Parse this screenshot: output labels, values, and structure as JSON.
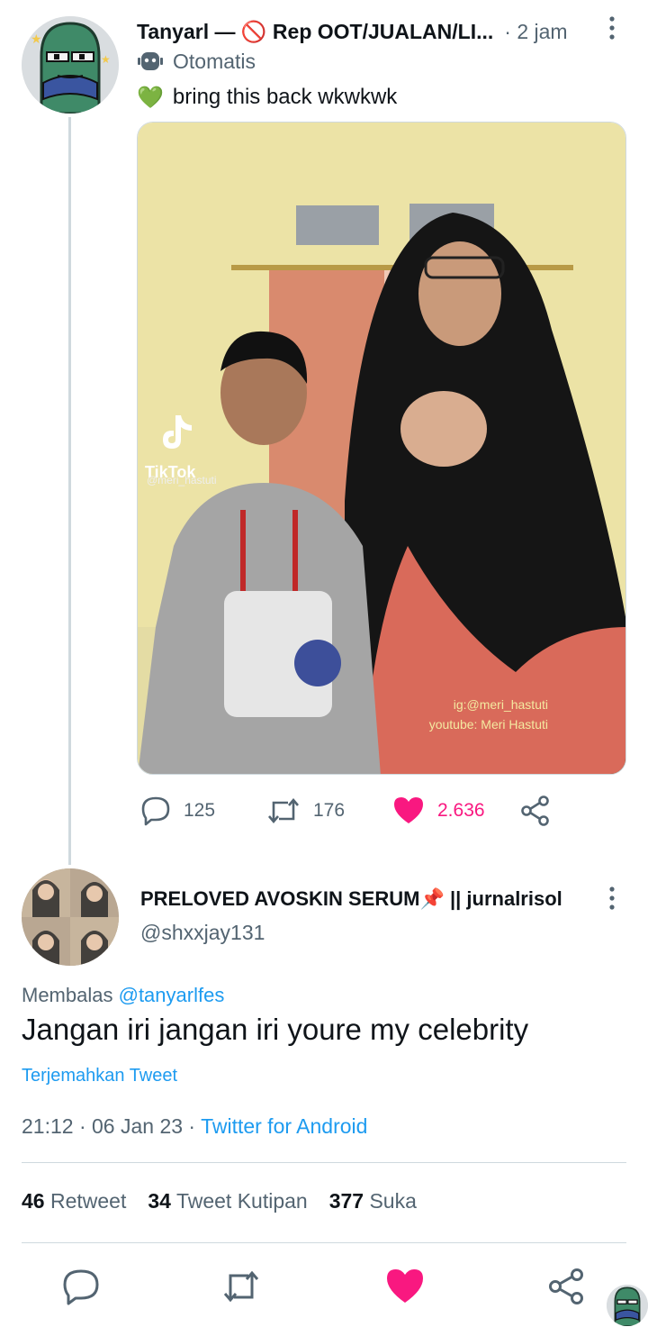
{
  "tweet1": {
    "display_name": "Tanyarl — 🚫 Rep OOT/JUALAN/LI...",
    "time": "· 2 jam",
    "automated_label": "Otomatis",
    "emoji": "💚",
    "text": "bring this back wkwkwk",
    "media_watermark": {
      "brand": "TikTok",
      "handle": "@meri_hastuti",
      "ig": "ig:@meri_hastuti",
      "youtube": "youtube: Meri Hastuti"
    },
    "actions": {
      "replies": "125",
      "retweets": "176",
      "likes": "2.636",
      "liked": true
    }
  },
  "tweet2": {
    "display_name": "PRELOVED AVOSKIN SERUM📌 || jurnalrisol",
    "handle": "@shxxjay131",
    "replying_prefix": "Membalas",
    "replying_to": "@tanyarlfes",
    "text": "Jangan iri jangan iri youre my celebrity",
    "translate_label": "Terjemahkan Tweet",
    "timestamp": "21:12 · 06 Jan 23 ·",
    "source": "Twitter for Android",
    "stats": {
      "retweets_count": "46",
      "retweets_label": "Retweet",
      "quotes_count": "34",
      "quotes_label": "Tweet Kutipan",
      "likes_count": "377",
      "likes_label": "Suka"
    }
  },
  "colors": {
    "accent": "#1d9bf0",
    "like": "#f91880",
    "secondary_text": "#536471",
    "divider": "#cfd9de"
  },
  "icons": [
    "more-vertical-icon",
    "bot-icon",
    "reply-icon",
    "retweet-icon",
    "like-icon",
    "share-icon"
  ]
}
